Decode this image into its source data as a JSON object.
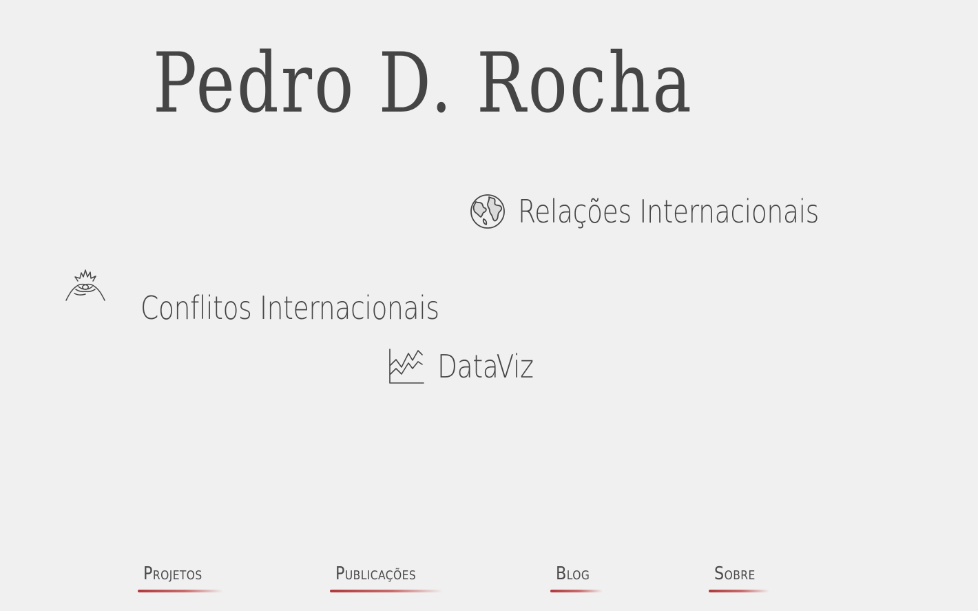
{
  "header": {
    "title": "Pedro D. Rocha"
  },
  "topics": [
    {
      "label": "Relações Internacionais",
      "icon": "globe-icon"
    },
    {
      "label": "Conflitos Internacionais",
      "icon": "conflict-hands-icon"
    },
    {
      "label": "DataViz",
      "icon": "line-chart-icon"
    }
  ],
  "nav": {
    "items": [
      {
        "label": "Projetos"
      },
      {
        "label": "Publicações"
      },
      {
        "label": "Blog"
      },
      {
        "label": "Sobre"
      }
    ]
  },
  "colors": {
    "background": "#f0f0f0",
    "text": "#454545",
    "accent": "#b0393b"
  }
}
